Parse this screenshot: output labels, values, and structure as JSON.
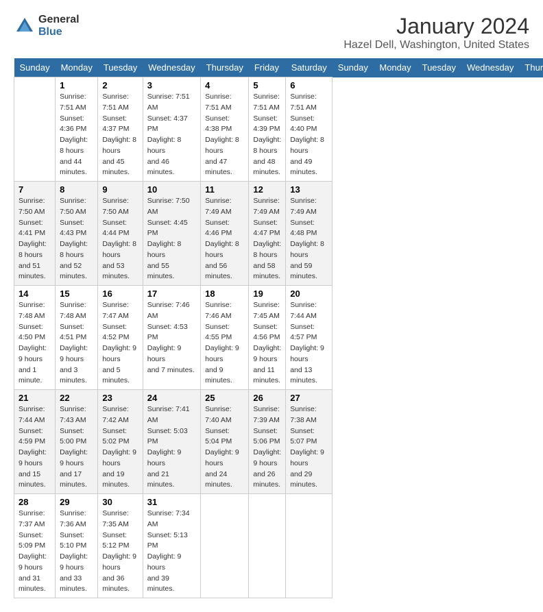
{
  "header": {
    "logo_general": "General",
    "logo_blue": "Blue",
    "month_title": "January 2024",
    "location": "Hazel Dell, Washington, United States"
  },
  "days_of_week": [
    "Sunday",
    "Monday",
    "Tuesday",
    "Wednesday",
    "Thursday",
    "Friday",
    "Saturday"
  ],
  "weeks": [
    [
      {
        "day": "",
        "info": []
      },
      {
        "day": "1",
        "info": [
          "Sunrise: 7:51 AM",
          "Sunset: 4:36 PM",
          "Daylight: 8 hours",
          "and 44 minutes."
        ]
      },
      {
        "day": "2",
        "info": [
          "Sunrise: 7:51 AM",
          "Sunset: 4:37 PM",
          "Daylight: 8 hours",
          "and 45 minutes."
        ]
      },
      {
        "day": "3",
        "info": [
          "Sunrise: 7:51 AM",
          "Sunset: 4:37 PM",
          "Daylight: 8 hours",
          "and 46 minutes."
        ]
      },
      {
        "day": "4",
        "info": [
          "Sunrise: 7:51 AM",
          "Sunset: 4:38 PM",
          "Daylight: 8 hours",
          "and 47 minutes."
        ]
      },
      {
        "day": "5",
        "info": [
          "Sunrise: 7:51 AM",
          "Sunset: 4:39 PM",
          "Daylight: 8 hours",
          "and 48 minutes."
        ]
      },
      {
        "day": "6",
        "info": [
          "Sunrise: 7:51 AM",
          "Sunset: 4:40 PM",
          "Daylight: 8 hours",
          "and 49 minutes."
        ]
      }
    ],
    [
      {
        "day": "7",
        "info": [
          "Sunrise: 7:50 AM",
          "Sunset: 4:41 PM",
          "Daylight: 8 hours",
          "and 51 minutes."
        ]
      },
      {
        "day": "8",
        "info": [
          "Sunrise: 7:50 AM",
          "Sunset: 4:43 PM",
          "Daylight: 8 hours",
          "and 52 minutes."
        ]
      },
      {
        "day": "9",
        "info": [
          "Sunrise: 7:50 AM",
          "Sunset: 4:44 PM",
          "Daylight: 8 hours",
          "and 53 minutes."
        ]
      },
      {
        "day": "10",
        "info": [
          "Sunrise: 7:50 AM",
          "Sunset: 4:45 PM",
          "Daylight: 8 hours",
          "and 55 minutes."
        ]
      },
      {
        "day": "11",
        "info": [
          "Sunrise: 7:49 AM",
          "Sunset: 4:46 PM",
          "Daylight: 8 hours",
          "and 56 minutes."
        ]
      },
      {
        "day": "12",
        "info": [
          "Sunrise: 7:49 AM",
          "Sunset: 4:47 PM",
          "Daylight: 8 hours",
          "and 58 minutes."
        ]
      },
      {
        "day": "13",
        "info": [
          "Sunrise: 7:49 AM",
          "Sunset: 4:48 PM",
          "Daylight: 8 hours",
          "and 59 minutes."
        ]
      }
    ],
    [
      {
        "day": "14",
        "info": [
          "Sunrise: 7:48 AM",
          "Sunset: 4:50 PM",
          "Daylight: 9 hours",
          "and 1 minute."
        ]
      },
      {
        "day": "15",
        "info": [
          "Sunrise: 7:48 AM",
          "Sunset: 4:51 PM",
          "Daylight: 9 hours",
          "and 3 minutes."
        ]
      },
      {
        "day": "16",
        "info": [
          "Sunrise: 7:47 AM",
          "Sunset: 4:52 PM",
          "Daylight: 9 hours",
          "and 5 minutes."
        ]
      },
      {
        "day": "17",
        "info": [
          "Sunrise: 7:46 AM",
          "Sunset: 4:53 PM",
          "Daylight: 9 hours",
          "and 7 minutes."
        ]
      },
      {
        "day": "18",
        "info": [
          "Sunrise: 7:46 AM",
          "Sunset: 4:55 PM",
          "Daylight: 9 hours",
          "and 9 minutes."
        ]
      },
      {
        "day": "19",
        "info": [
          "Sunrise: 7:45 AM",
          "Sunset: 4:56 PM",
          "Daylight: 9 hours",
          "and 11 minutes."
        ]
      },
      {
        "day": "20",
        "info": [
          "Sunrise: 7:44 AM",
          "Sunset: 4:57 PM",
          "Daylight: 9 hours",
          "and 13 minutes."
        ]
      }
    ],
    [
      {
        "day": "21",
        "info": [
          "Sunrise: 7:44 AM",
          "Sunset: 4:59 PM",
          "Daylight: 9 hours",
          "and 15 minutes."
        ]
      },
      {
        "day": "22",
        "info": [
          "Sunrise: 7:43 AM",
          "Sunset: 5:00 PM",
          "Daylight: 9 hours",
          "and 17 minutes."
        ]
      },
      {
        "day": "23",
        "info": [
          "Sunrise: 7:42 AM",
          "Sunset: 5:02 PM",
          "Daylight: 9 hours",
          "and 19 minutes."
        ]
      },
      {
        "day": "24",
        "info": [
          "Sunrise: 7:41 AM",
          "Sunset: 5:03 PM",
          "Daylight: 9 hours",
          "and 21 minutes."
        ]
      },
      {
        "day": "25",
        "info": [
          "Sunrise: 7:40 AM",
          "Sunset: 5:04 PM",
          "Daylight: 9 hours",
          "and 24 minutes."
        ]
      },
      {
        "day": "26",
        "info": [
          "Sunrise: 7:39 AM",
          "Sunset: 5:06 PM",
          "Daylight: 9 hours",
          "and 26 minutes."
        ]
      },
      {
        "day": "27",
        "info": [
          "Sunrise: 7:38 AM",
          "Sunset: 5:07 PM",
          "Daylight: 9 hours",
          "and 29 minutes."
        ]
      }
    ],
    [
      {
        "day": "28",
        "info": [
          "Sunrise: 7:37 AM",
          "Sunset: 5:09 PM",
          "Daylight: 9 hours",
          "and 31 minutes."
        ]
      },
      {
        "day": "29",
        "info": [
          "Sunrise: 7:36 AM",
          "Sunset: 5:10 PM",
          "Daylight: 9 hours",
          "and 33 minutes."
        ]
      },
      {
        "day": "30",
        "info": [
          "Sunrise: 7:35 AM",
          "Sunset: 5:12 PM",
          "Daylight: 9 hours",
          "and 36 minutes."
        ]
      },
      {
        "day": "31",
        "info": [
          "Sunrise: 7:34 AM",
          "Sunset: 5:13 PM",
          "Daylight: 9 hours",
          "and 39 minutes."
        ]
      },
      {
        "day": "",
        "info": []
      },
      {
        "day": "",
        "info": []
      },
      {
        "day": "",
        "info": []
      }
    ]
  ]
}
